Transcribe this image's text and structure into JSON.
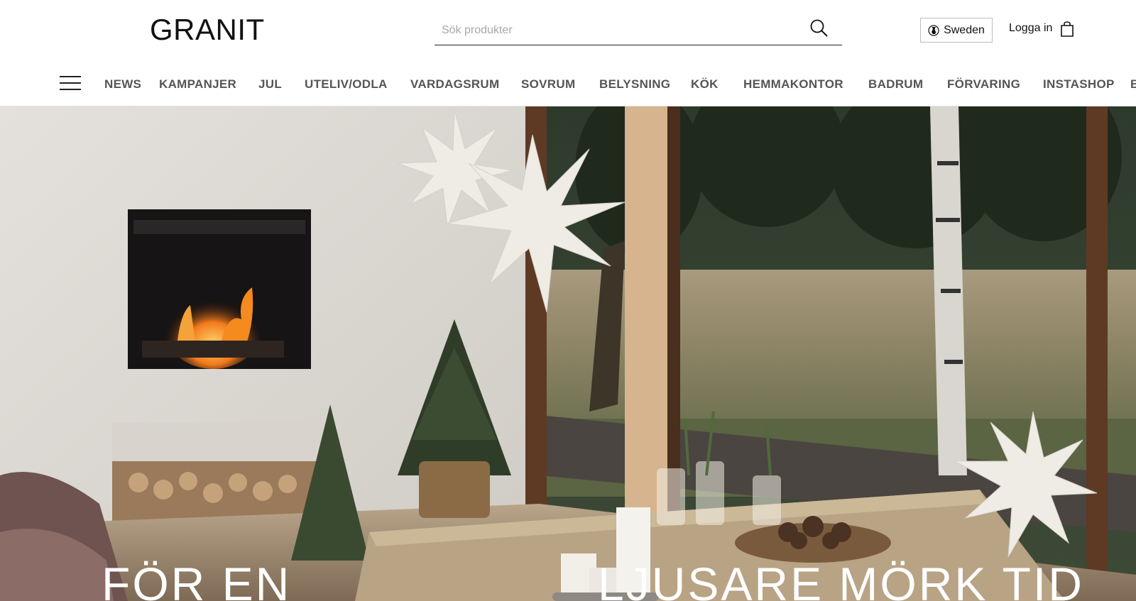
{
  "header": {
    "logo": "GRANIT",
    "search_placeholder": "Sök produkter",
    "search_icon": "search-icon",
    "region_label": "Sweden",
    "region_icon": "globe-icon",
    "login_label": "Logga in",
    "cart_icon": "shopping-bag-icon"
  },
  "nav": {
    "menu_icon": "hamburger-icon",
    "items": [
      {
        "label": "NEWS"
      },
      {
        "label": "KAMPANJER"
      },
      {
        "label": "JUL"
      },
      {
        "label": "UTELIV/ODLA"
      },
      {
        "label": "VARDAGSRUM"
      },
      {
        "label": "SOVRUM"
      },
      {
        "label": "BELYSNING"
      },
      {
        "label": "KÖK"
      },
      {
        "label": "HEMMAKONTOR"
      },
      {
        "label": "BADRUM"
      },
      {
        "label": "FÖRVARING"
      },
      {
        "label": "INSTASHOP"
      },
      {
        "label": "B"
      }
    ]
  },
  "hero": {
    "headline_left": "FÖR EN",
    "headline_right": "LJUSARE MÖRK TID"
  },
  "colors": {
    "text": "#1a1a1a",
    "nav_text": "#555555",
    "hero_text": "#ffffff"
  }
}
